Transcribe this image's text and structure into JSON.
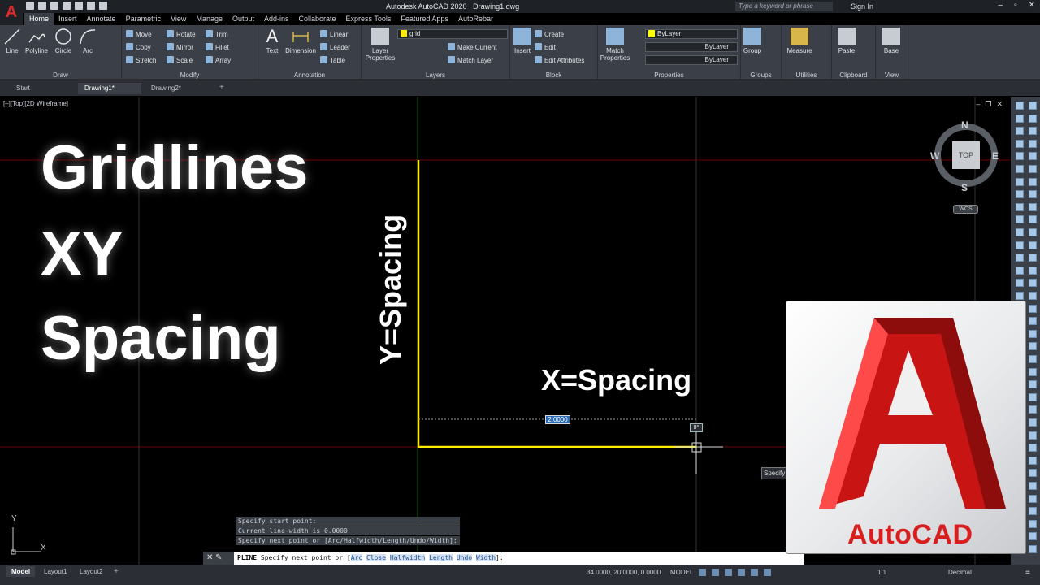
{
  "titlebar": {
    "app_title": "Autodesk AutoCAD 2020",
    "doc_title": "Drawing1.dwg",
    "search_placeholder": "Type a keyword or phrase",
    "sign_in": "Sign In"
  },
  "ribbon_tabs": [
    "Home",
    "Insert",
    "Annotate",
    "Parametric",
    "View",
    "Manage",
    "Output",
    "Add-ins",
    "Collaborate",
    "Express Tools",
    "Featured Apps",
    "AutoRebar"
  ],
  "ribbon": {
    "draw": {
      "title": "Draw",
      "line": "Line",
      "polyline": "Polyline",
      "circle": "Circle",
      "arc": "Arc"
    },
    "modify": {
      "title": "Modify",
      "move": "Move",
      "rotate": "Rotate",
      "trim": "Trim",
      "copy": "Copy",
      "mirror": "Mirror",
      "fillet": "Fillet",
      "stretch": "Stretch",
      "scale": "Scale",
      "array": "Array"
    },
    "annotation": {
      "title": "Annotation",
      "text": "Text",
      "dimension": "Dimension",
      "linear": "Linear",
      "leader": "Leader",
      "table": "Table"
    },
    "layers": {
      "title": "Layers",
      "layer_properties": "Layer Properties",
      "layer_value": "grid",
      "make_current": "Make Current",
      "match_layer": "Match Layer"
    },
    "block": {
      "title": "Block",
      "insert": "Insert",
      "create": "Create",
      "edit": "Edit",
      "edit_attributes": "Edit Attributes"
    },
    "properties": {
      "title": "Properties",
      "match_properties": "Match Properties",
      "color": "ByLayer",
      "linetype": "ByLayer",
      "lineweight": "ByLayer"
    },
    "groups": {
      "title": "Groups",
      "group": "Group"
    },
    "utilities": {
      "title": "Utilities",
      "measure": "Measure"
    },
    "clipboard": {
      "title": "Clipboard",
      "paste": "Paste"
    },
    "view": {
      "title": "View",
      "base": "Base"
    }
  },
  "doc_tabs": [
    "Start",
    "Drawing1*",
    "Drawing2*"
  ],
  "viewport": {
    "label": "[–][Top][2D Wireframe]",
    "overlay_lines": [
      "Gridlines",
      "XY",
      "Spacing"
    ],
    "y_label": "Y=Spacing",
    "x_label": "X=Spacing",
    "dim_value": "2.0000",
    "angle_value": "0°",
    "tooltip": "Specify"
  },
  "viewcube": {
    "n": "N",
    "s": "S",
    "e": "E",
    "w": "W",
    "top": "TOP",
    "wcs": "WCS"
  },
  "ucs": {
    "x": "X",
    "y": "Y"
  },
  "command_history": [
    "Specify start point:",
    "Current line-width is 0.0000",
    "Specify next point or [Arc/Halfwidth/Length/Undo/Width]:"
  ],
  "command_line": {
    "prefix": "PLINE",
    "prompt": "Specify next point or [",
    "options": [
      "Arc",
      "Close",
      "Halfwidth",
      "Length",
      "Undo",
      "Width"
    ],
    "suffix": "]:"
  },
  "status": {
    "layout_tabs": [
      "Model",
      "Layout1",
      "Layout2"
    ],
    "coordinates": "34.0000, 20.0000, 0.0000",
    "model": "MODEL",
    "scale": "1:1",
    "units": "Decimal"
  },
  "logo": {
    "text": "AutoCAD"
  },
  "colors": {
    "accent_red": "#d81e1e",
    "polyline_yellow": "#ffeb00",
    "grid_red": "#8b0000",
    "grid_green": "#0b5d0b"
  }
}
